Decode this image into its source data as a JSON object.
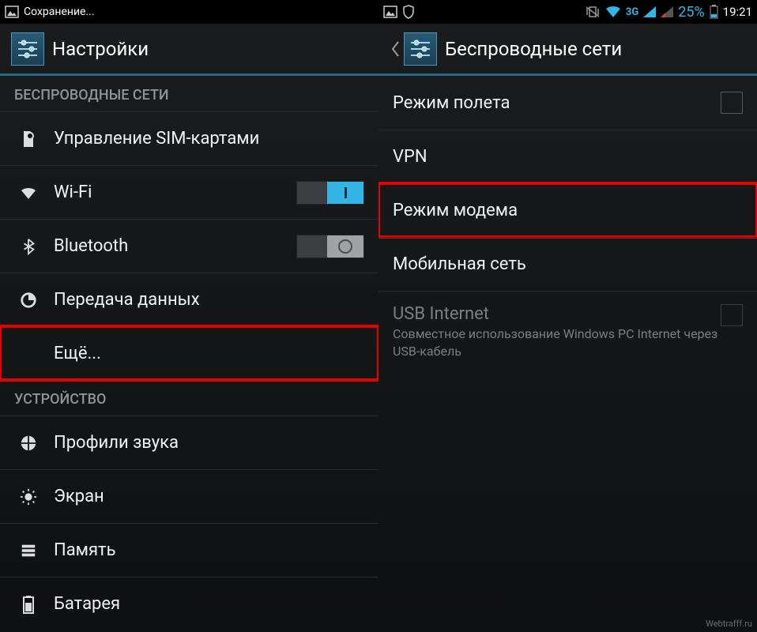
{
  "status": {
    "left_text": "Сохранение...",
    "network_label": "3G",
    "battery_pct": "25%",
    "time": "19:21"
  },
  "left": {
    "header": "Настройки",
    "section_wireless": "БЕСПРОВОДНЫЕ СЕТИ",
    "sim_mgmt": "Управление SIM-картами",
    "wifi": "Wi-Fi",
    "bluetooth": "Bluetooth",
    "data_usage": "Передача данных",
    "more": "Ещё...",
    "section_device": "УСТРОЙСТВО",
    "sound_profiles": "Профили звука",
    "display": "Экран",
    "storage": "Память",
    "battery": "Батарея"
  },
  "right": {
    "header": "Беспроводные сети",
    "airplane": "Режим полета",
    "vpn": "VPN",
    "tethering": "Режим модема",
    "mobile_net": "Мобильная сеть",
    "usb_internet": "USB Internet",
    "usb_internet_sub": "Совместное использование Windows PC Internet через USB-кабель"
  },
  "watermark": "Webtrafff.ru"
}
